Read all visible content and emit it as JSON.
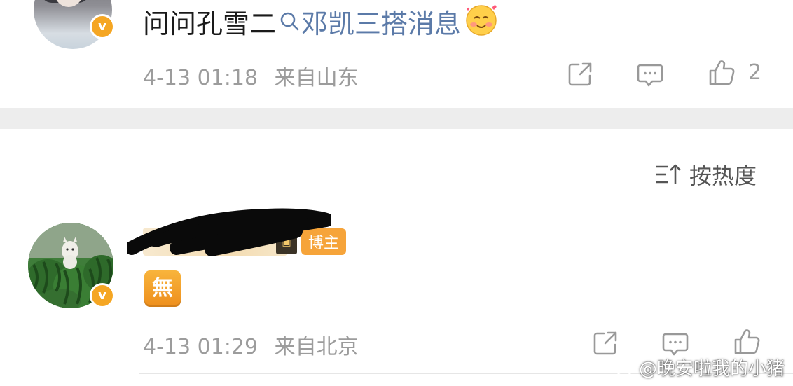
{
  "comment_1": {
    "text": "问问孔雪二",
    "search_link": "邓凯三搭消息",
    "time": "4-13 01:18",
    "location": "来自山东",
    "like_count": "2"
  },
  "sort": {
    "label": "按热度"
  },
  "comment_2": {
    "blogger_badge": "博主",
    "sticker": "無",
    "time": "4-13 01:29",
    "location": "来自北京"
  },
  "watermark": {
    "text": "@晚安啦我的小猪"
  },
  "icons": {
    "share": "share-icon",
    "comment": "comment-icon",
    "like": "thumbs-up-icon",
    "sort": "sort-icon",
    "search": "search-icon",
    "verified": "verified-v-icon"
  },
  "colors": {
    "link": "#5b7aa8",
    "meta": "#9c9c9c",
    "badge": "#f5a623",
    "divider": "#ededed"
  }
}
